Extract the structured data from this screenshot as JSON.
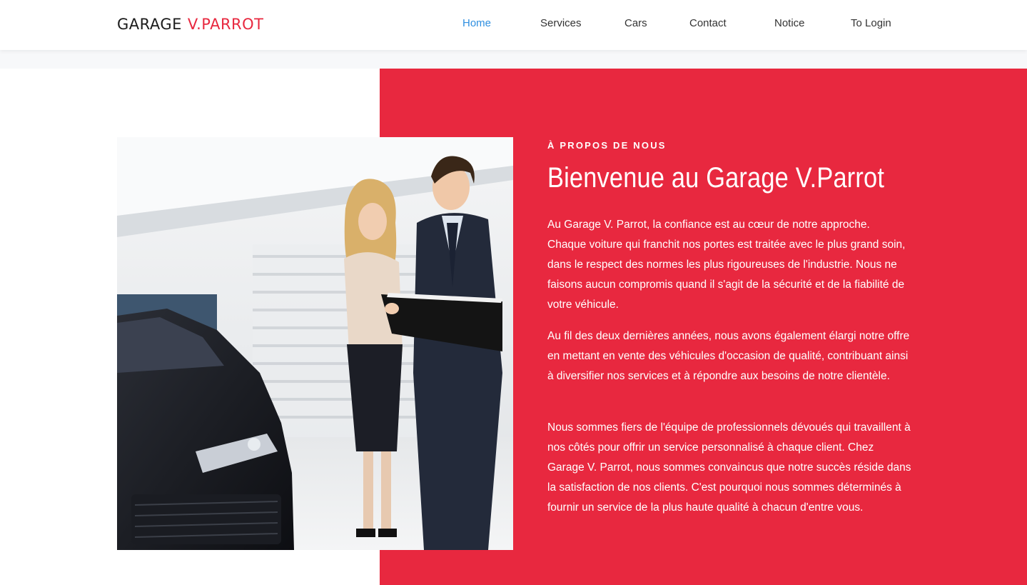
{
  "brand": {
    "name": "GARAGE",
    "accent": "V.PARROT"
  },
  "nav": {
    "items": [
      {
        "label": "Home"
      },
      {
        "label": "Services"
      },
      {
        "label": "Cars"
      },
      {
        "label": "Contact"
      },
      {
        "label": "Notice"
      },
      {
        "label": "To Login"
      }
    ],
    "active_index": 0
  },
  "about": {
    "eyebrow": "À PROPOS DE NOUS",
    "title": "Bienvenue au Garage V.Parrot",
    "paragraphs": [
      "Au Garage V. Parrot, la confiance est au cœur de notre approche. Chaque voiture qui franchit nos portes est traitée avec le plus grand soin, dans le respect des normes les plus rigoureuses de l'industrie. Nous ne faisons aucun compromis quand il s'agit de la sécurité et de la fiabilité de votre véhicule.",
      "Au fil des deux dernières années, nous avons également élargi notre offre en mettant en vente des véhicules d'occasion de qualité, contribuant ainsi à diversifier nos services et à répondre aux besoins de notre clientèle.",
      "Nous sommes fiers de l'équipe de professionnels dévoués qui travaillent à nos côtés pour offrir un service personnalisé à chaque client. Chez Garage V. Parrot, nous sommes convaincus que notre succès réside dans la satisfaction de nos clients. C'est pourquoi nous sommes déterminés à fournir un service de la plus haute qualité à chacun d'entre vous."
    ]
  },
  "colors": {
    "accent": "#e8283f",
    "nav_active": "#2f8fe0",
    "text_dark": "#1b1b1b"
  }
}
